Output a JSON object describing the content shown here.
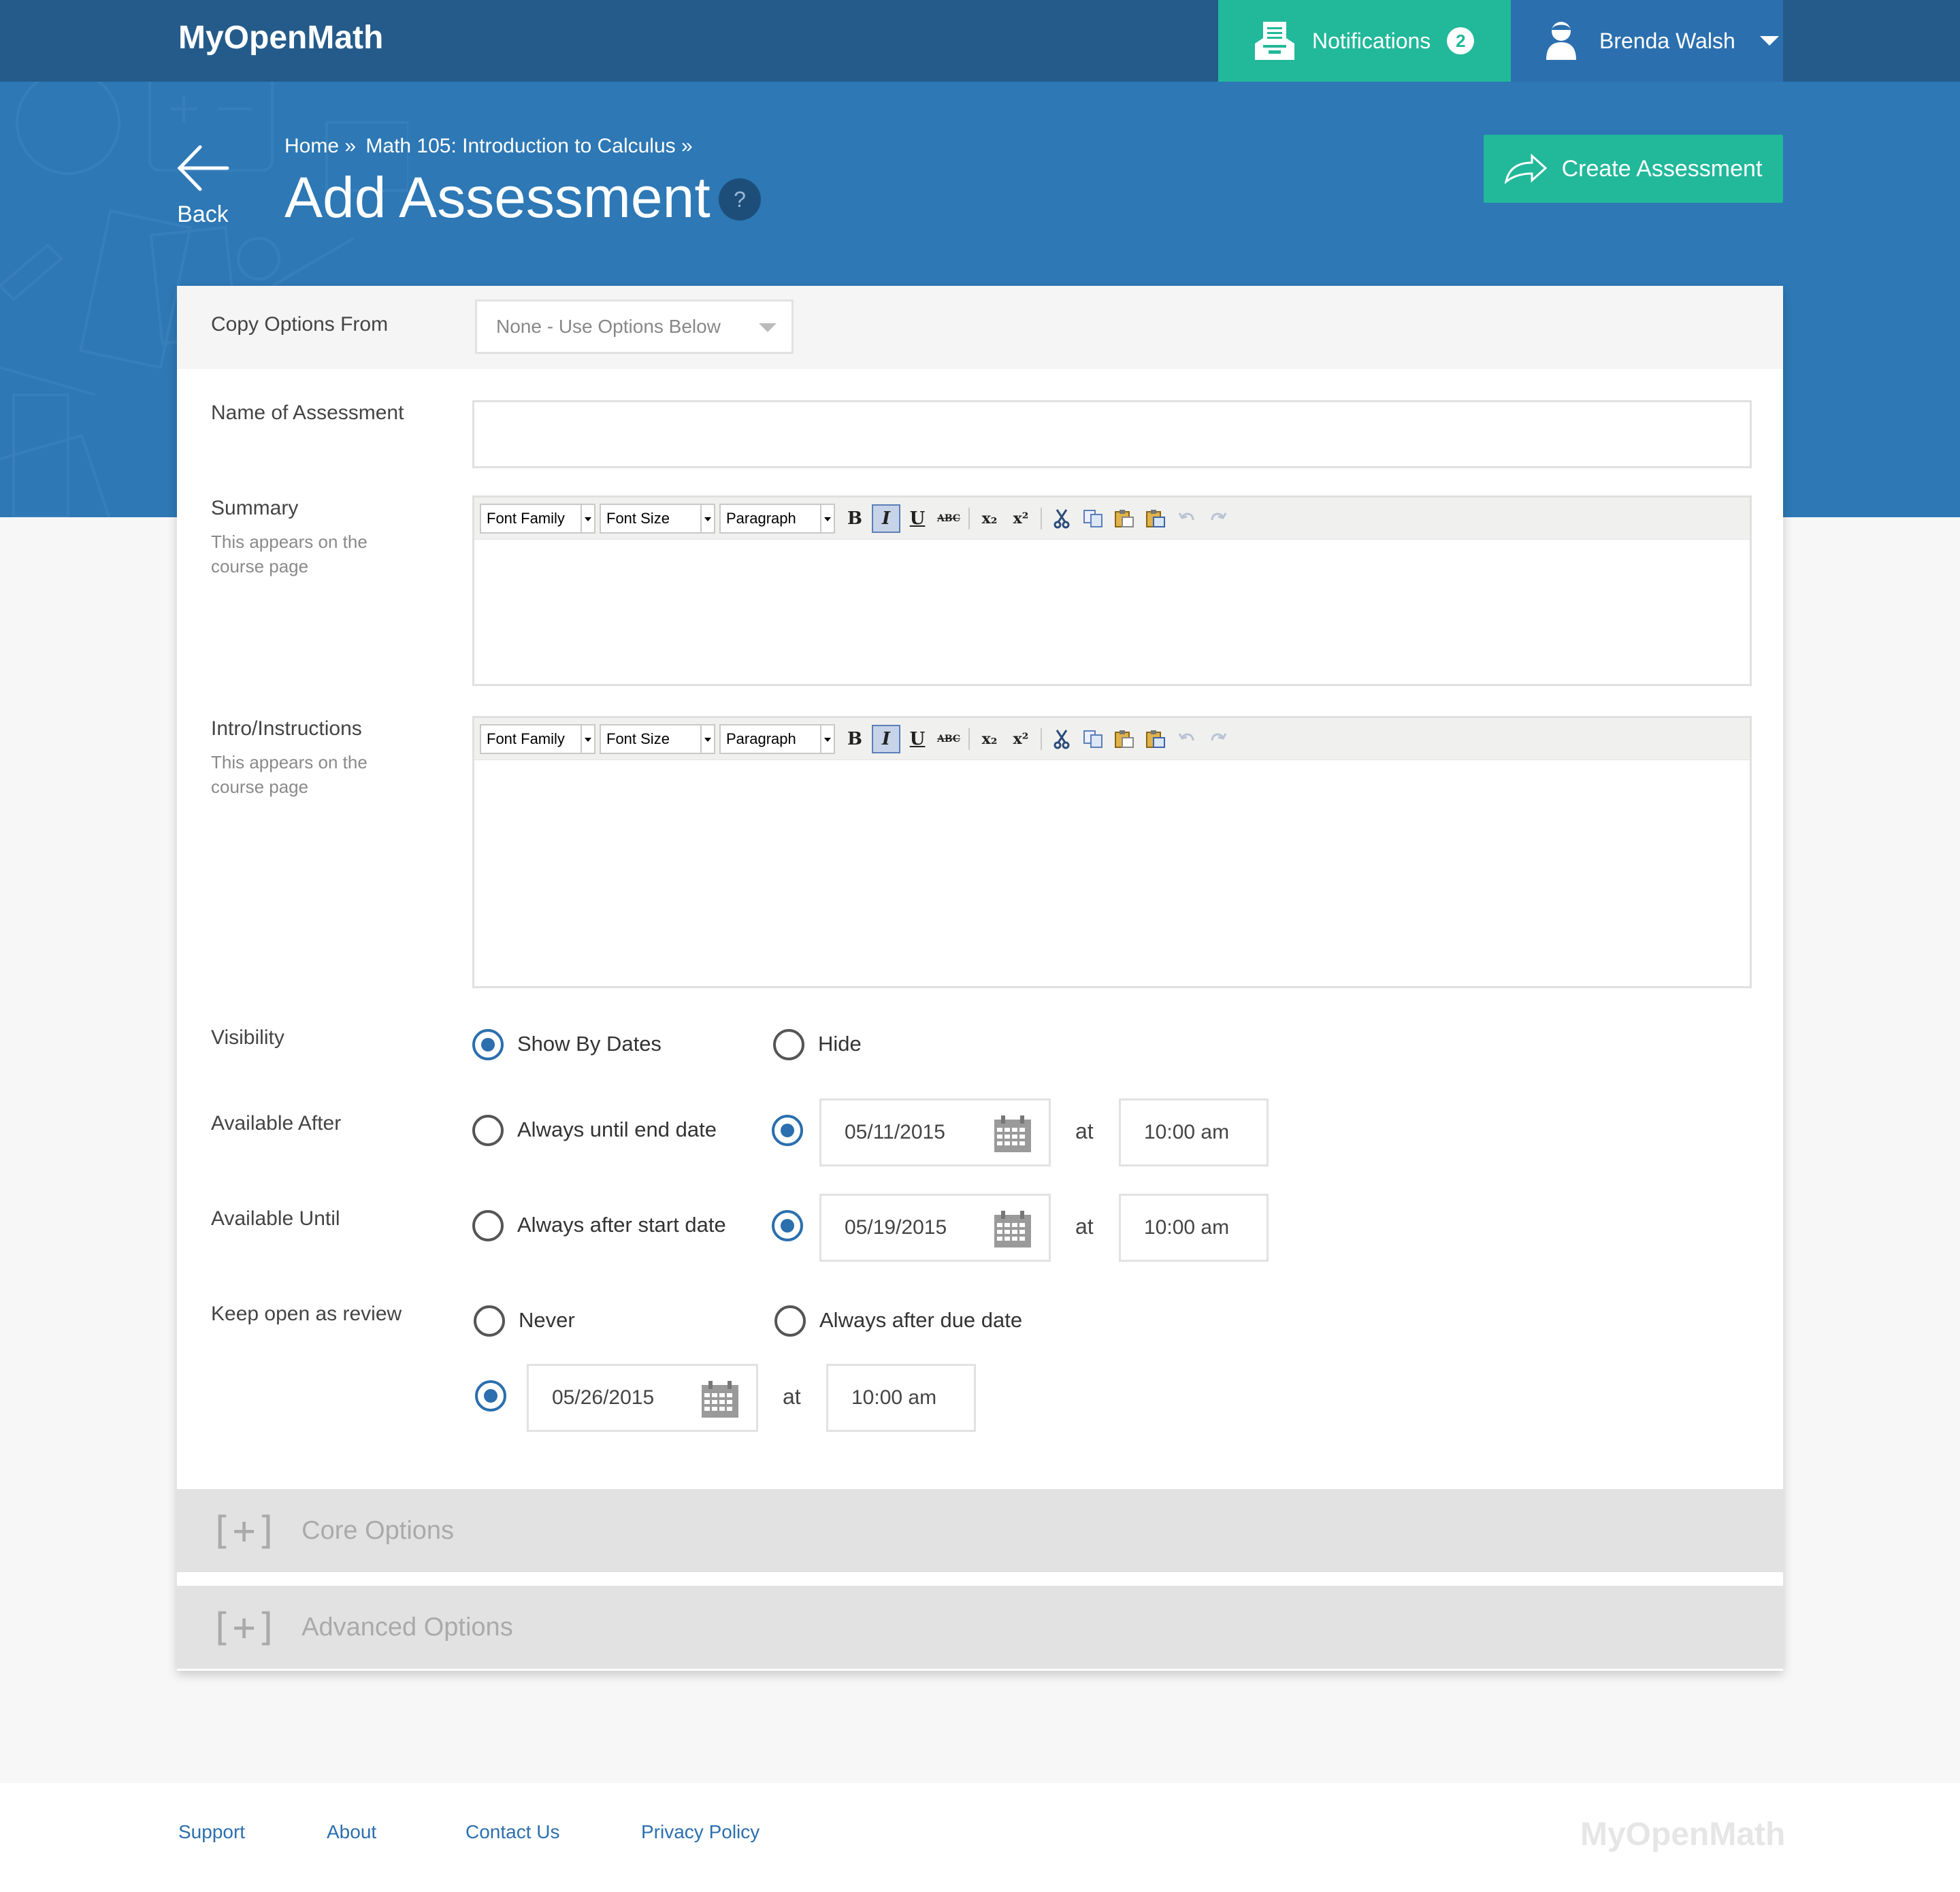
{
  "topbar": {
    "logo": "MyOpenMath",
    "notifications_label": "Notifications",
    "notifications_count": "2",
    "user_name": "Brenda Walsh"
  },
  "hero": {
    "back_label": "Back",
    "breadcrumb": [
      "Home »",
      "Math 105: Introduction to Calculus »"
    ],
    "title": "Add Assessment",
    "help": "?",
    "create_label": "Create Assessment"
  },
  "form": {
    "copy_label": "Copy Options From",
    "copy_value": "None - Use Options Below",
    "name_label": "Name of Assessment",
    "name_value": "",
    "summary_label": "Summary",
    "summary_sub": "This appears on the course page",
    "intro_label": "Intro/Instructions",
    "intro_sub": "This appears on the course page",
    "editor_toolbar": {
      "font_family": "Font Family",
      "font_size": "Font Size",
      "format": "Paragraph",
      "bold": "B",
      "italic": "I",
      "underline": "U",
      "strike": "ABC",
      "subscript": "x₂",
      "superscript": "x²"
    },
    "visibility_label": "Visibility",
    "visibility_options": [
      "Show By Dates",
      "Hide"
    ],
    "visibility_selected": "Show By Dates",
    "available_after_label": "Available After",
    "available_after_option": "Always until end date",
    "available_after_date": "05/11/2015",
    "available_after_time": "10:00 am",
    "available_until_label": "Available Until",
    "available_until_option": "Always after start date",
    "available_until_date": "05/19/2015",
    "available_until_time": "10:00 am",
    "review_label": "Keep open as review",
    "review_options": [
      "Never",
      "Always after due date"
    ],
    "review_date": "05/26/2015",
    "review_time": "10:00 am",
    "at_label": "at"
  },
  "sections": {
    "core": "Core Options",
    "advanced": "Advanced Options",
    "expand_symbol": "[+]"
  },
  "footer": {
    "links": [
      "Support",
      "About",
      "Contact Us",
      "Privacy Policy"
    ],
    "logo": "MyOpenMath"
  },
  "colors": {
    "nav_dark": "#245b8a",
    "hero_blue": "#2d78b5",
    "accent_green": "#22b89a",
    "link_blue": "#2b6fae"
  }
}
